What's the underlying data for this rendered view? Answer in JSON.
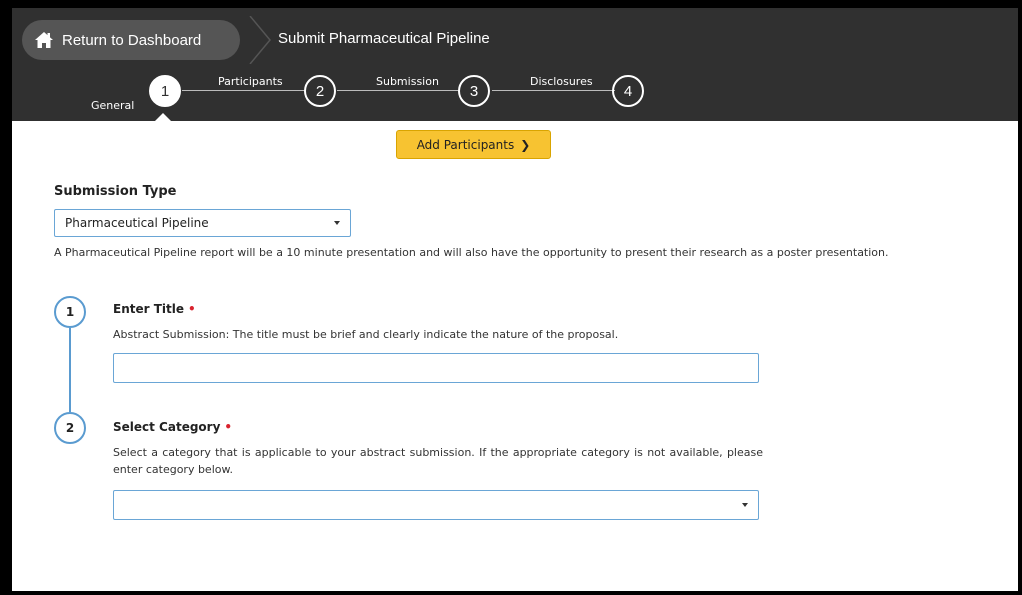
{
  "header": {
    "return_label": "Return to Dashboard",
    "page_title": "Submit Pharmaceutical Pipeline",
    "steps": [
      {
        "number": "1",
        "label": "General"
      },
      {
        "number": "2",
        "label": "Participants"
      },
      {
        "number": "3",
        "label": "Submission"
      },
      {
        "number": "4",
        "label": "Disclosures"
      }
    ],
    "active_step": "1"
  },
  "main": {
    "add_participants_label": "Add Participants",
    "submission_type": {
      "label": "Submission Type",
      "selected": "Pharmaceutical Pipeline",
      "description": "A Pharmaceutical Pipeline report will be a 10 minute presentation and will also have the opportunity to present their research as a poster presentation."
    },
    "fields": [
      {
        "number": "1",
        "title": "Enter Title",
        "required_mark": "•",
        "description": "Abstract Submission: The title must be brief and clearly indicate the nature of the proposal.",
        "value": ""
      },
      {
        "number": "2",
        "title": "Select Category",
        "required_mark": "•",
        "description": "Select a category that is applicable to your abstract submission. If the appropriate category is not available, please enter category below.",
        "value": ""
      }
    ]
  },
  "colors": {
    "header_bg": "#303030",
    "accent_yellow": "#f7c331",
    "input_border": "#6aa6d6",
    "required_red": "#d9232e"
  }
}
